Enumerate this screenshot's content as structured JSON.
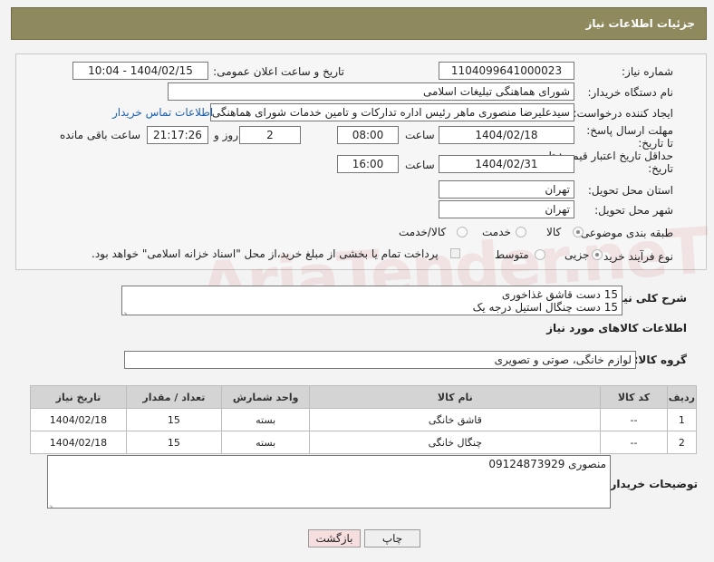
{
  "header": {
    "title": "جزئیات اطلاعات نیاز"
  },
  "form": {
    "need_number_label": "شماره نیاز:",
    "need_number": "1104099641000023",
    "announce_label": "تاریخ و ساعت اعلان عمومی:",
    "announce_value": "1404/02/15 - 10:04",
    "buyer_org_label": "نام دستگاه خریدار:",
    "buyer_org": "شورای هماهنگی تبلیغات اسلامی",
    "creator_label": "ایجاد کننده درخواست:",
    "creator": "سیدعلیرضا منصوری ماهر رئیس اداره تدارکات و تامین خدمات  شورای هماهنگی تبلیغات اسلامی",
    "contact_link": "اطلاعات تماس خریدار",
    "reply_deadline_label": "مهلت ارسال پاسخ: تا تاریخ:",
    "reply_date": "1404/02/18",
    "hour_label": "ساعت",
    "reply_time": "08:00",
    "days_value": "2",
    "days_label": "روز و",
    "remaining_time": "21:17:26",
    "remaining_label": "ساعت باقی مانده",
    "price_validity_label": "حداقل تاریخ اعتبار قیمت: تا تاریخ:",
    "price_date": "1404/02/31",
    "price_time": "16:00",
    "province_label": "استان محل تحویل:",
    "province": "تهران",
    "city_label": "شهر محل تحویل:",
    "city": "تهران",
    "category_label": "طبقه بندی موضوعی:",
    "category_options": [
      "کالا",
      "خدمت",
      "کالا/خدمت"
    ],
    "category_selected": "کالا",
    "process_label": "نوع فرآیند خرید :",
    "process_options": [
      "جزیی",
      "متوسط"
    ],
    "process_note": "پرداخت تمام یا بخشی از مبلغ خرید،از محل \"اسناد خزانه اسلامی\" خواهد بود."
  },
  "description": {
    "label": "شرح کلی نیاز:",
    "lines": [
      "15 دست قاشق غذاخوری",
      "15 دست چنگال استیل درجه یک"
    ]
  },
  "goods": {
    "section_title": "اطلاعات کالاهای مورد نیاز",
    "group_label": "گروه کالا:",
    "group_value": "لوازم خانگی، صوتی و تصویری",
    "columns": [
      "ردیف",
      "کد کالا",
      "نام کالا",
      "واحد شمارش",
      "تعداد / مقدار",
      "تاریخ نیاز"
    ],
    "rows": [
      [
        "1",
        "--",
        "قاشق خانگی",
        "بسته",
        "15",
        "1404/02/18"
      ],
      [
        "2",
        "--",
        "چنگال خانگی",
        "بسته",
        "15",
        "1404/02/18"
      ]
    ]
  },
  "buyer_notes": {
    "label": "توضیحات خریدار:",
    "text": "منصوری 09124873929"
  },
  "buttons": {
    "print": "چاپ",
    "back": "بازگشت"
  },
  "watermark": "AriaTender.neT",
  "colors": {
    "header_bg": "#8e8a5e",
    "link": "#1a5fb4",
    "back_btn_bg": "#f7dede"
  }
}
